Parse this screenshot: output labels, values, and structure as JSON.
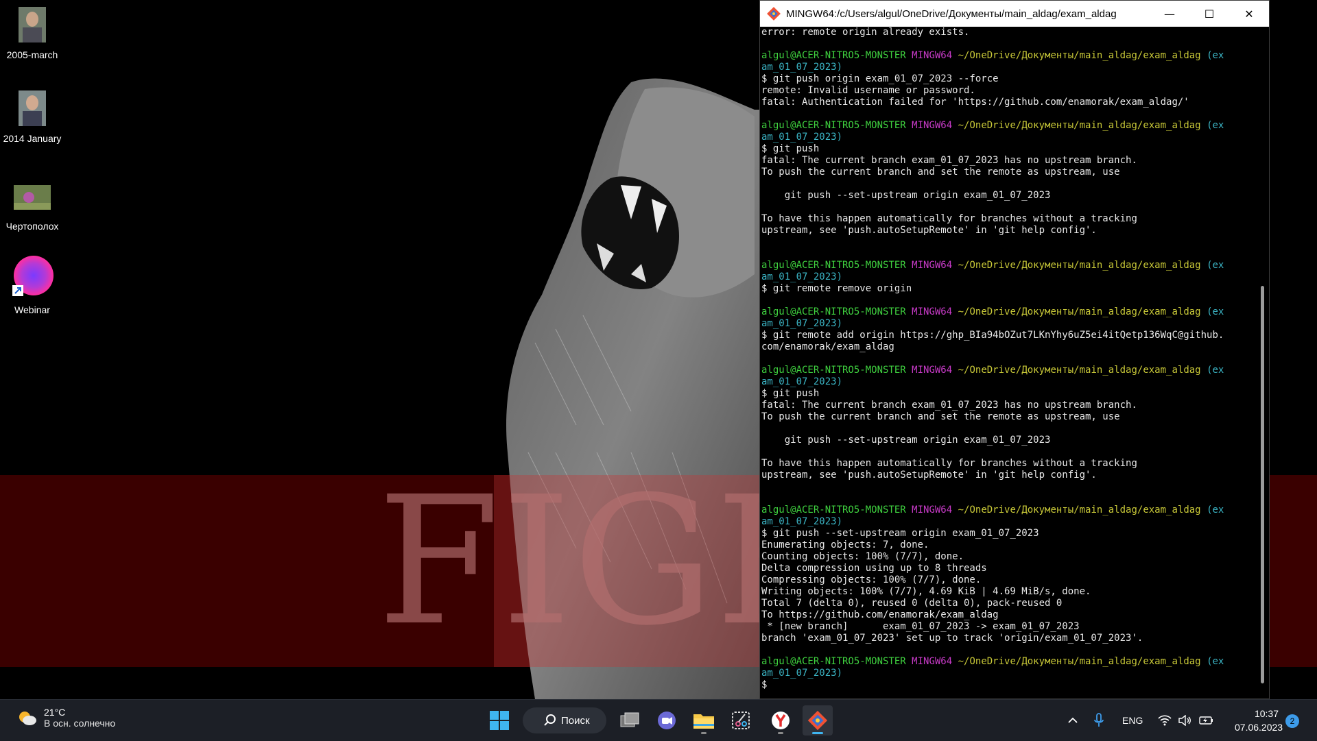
{
  "desktop": {
    "icons": [
      {
        "label": "2005-march"
      },
      {
        "label": "2014  January"
      },
      {
        "label": "Чертополох"
      },
      {
        "label": "Webinar"
      }
    ],
    "wallpaper_text": "FIGH"
  },
  "window": {
    "title": "MINGW64:/c/Users/algul/OneDrive/Документы/main_aldag/exam_aldag",
    "controls": {
      "minimize": "—",
      "maximize": "☐",
      "close": "✕"
    },
    "prompt": {
      "user": "algul@ACER-NITRO5-MONSTER",
      "shell": "MINGW64",
      "path": "~/OneDrive/Документы/main_aldag/exam_aldag",
      "branch_part1": "(ex",
      "branch_part2": "am_01_07_2023)"
    },
    "lines": [
      {
        "kind": "out",
        "text": "error: remote origin already exists."
      },
      {
        "kind": "blank",
        "text": ""
      },
      {
        "kind": "prompt",
        "text": ""
      },
      {
        "kind": "branch2",
        "text": ""
      },
      {
        "kind": "out",
        "text": "$ git push origin exam_01_07_2023 --force"
      },
      {
        "kind": "out",
        "text": "remote: Invalid username or password."
      },
      {
        "kind": "out",
        "text": "fatal: Authentication failed for 'https://github.com/enamorak/exam_aldag/'"
      },
      {
        "kind": "blank",
        "text": ""
      },
      {
        "kind": "prompt",
        "text": ""
      },
      {
        "kind": "branch2",
        "text": ""
      },
      {
        "kind": "out",
        "text": "$ git push"
      },
      {
        "kind": "out",
        "text": "fatal: The current branch exam_01_07_2023 has no upstream branch."
      },
      {
        "kind": "out",
        "text": "To push the current branch and set the remote as upstream, use"
      },
      {
        "kind": "blank",
        "text": ""
      },
      {
        "kind": "out",
        "text": "    git push --set-upstream origin exam_01_07_2023"
      },
      {
        "kind": "blank",
        "text": ""
      },
      {
        "kind": "out",
        "text": "To have this happen automatically for branches without a tracking"
      },
      {
        "kind": "out",
        "text": "upstream, see 'push.autoSetupRemote' in 'git help config'."
      },
      {
        "kind": "blank",
        "text": ""
      },
      {
        "kind": "blank",
        "text": ""
      },
      {
        "kind": "prompt",
        "text": ""
      },
      {
        "kind": "branch2",
        "text": ""
      },
      {
        "kind": "out",
        "text": "$ git remote remove origin"
      },
      {
        "kind": "blank",
        "text": ""
      },
      {
        "kind": "prompt",
        "text": ""
      },
      {
        "kind": "branch2",
        "text": ""
      },
      {
        "kind": "out",
        "text": "$ git remote add origin https://ghp_BIa94bOZut7LKnYhy6uZ5ei4itQetp136WqC@github."
      },
      {
        "kind": "out",
        "text": "com/enamorak/exam_aldag"
      },
      {
        "kind": "blank",
        "text": ""
      },
      {
        "kind": "prompt",
        "text": ""
      },
      {
        "kind": "branch2",
        "text": ""
      },
      {
        "kind": "out",
        "text": "$ git push"
      },
      {
        "kind": "out",
        "text": "fatal: The current branch exam_01_07_2023 has no upstream branch."
      },
      {
        "kind": "out",
        "text": "To push the current branch and set the remote as upstream, use"
      },
      {
        "kind": "blank",
        "text": ""
      },
      {
        "kind": "out",
        "text": "    git push --set-upstream origin exam_01_07_2023"
      },
      {
        "kind": "blank",
        "text": ""
      },
      {
        "kind": "out",
        "text": "To have this happen automatically for branches without a tracking"
      },
      {
        "kind": "out",
        "text": "upstream, see 'push.autoSetupRemote' in 'git help config'."
      },
      {
        "kind": "blank",
        "text": ""
      },
      {
        "kind": "blank",
        "text": ""
      },
      {
        "kind": "prompt",
        "text": ""
      },
      {
        "kind": "branch2",
        "text": ""
      },
      {
        "kind": "out",
        "text": "$ git push --set-upstream origin exam_01_07_2023"
      },
      {
        "kind": "out",
        "text": "Enumerating objects: 7, done."
      },
      {
        "kind": "out",
        "text": "Counting objects: 100% (7/7), done."
      },
      {
        "kind": "out",
        "text": "Delta compression using up to 8 threads"
      },
      {
        "kind": "out",
        "text": "Compressing objects: 100% (7/7), done."
      },
      {
        "kind": "out",
        "text": "Writing objects: 100% (7/7), 4.69 KiB | 4.69 MiB/s, done."
      },
      {
        "kind": "out",
        "text": "Total 7 (delta 0), reused 0 (delta 0), pack-reused 0"
      },
      {
        "kind": "out",
        "text": "To https://github.com/enamorak/exam_aldag"
      },
      {
        "kind": "out",
        "text": " * [new branch]      exam_01_07_2023 -> exam_01_07_2023"
      },
      {
        "kind": "out",
        "text": "branch 'exam_01_07_2023' set up to track 'origin/exam_01_07_2023'."
      },
      {
        "kind": "blank",
        "text": ""
      },
      {
        "kind": "prompt",
        "text": ""
      },
      {
        "kind": "branch2",
        "text": ""
      },
      {
        "kind": "out",
        "text": "$"
      }
    ]
  },
  "taskbar": {
    "weather": {
      "temp": "21°C",
      "desc": "В осн. солнечно"
    },
    "search_label": "Поиск",
    "tray": {
      "language": "ENG",
      "time": "10:37",
      "date": "07.06.2023",
      "notifications": "2"
    },
    "apps": [
      {
        "name": "start",
        "icon": "windows-logo"
      },
      {
        "name": "search",
        "icon": "search-icon"
      },
      {
        "name": "task-view",
        "icon": "task-view-icon"
      },
      {
        "name": "chat",
        "icon": "video-chat-icon"
      },
      {
        "name": "file-explorer",
        "icon": "folder-icon"
      },
      {
        "name": "snipping-tool",
        "icon": "snipping-icon"
      },
      {
        "name": "yandex-browser",
        "icon": "yandex-icon"
      },
      {
        "name": "git-bash",
        "icon": "git-icon"
      }
    ]
  },
  "colors": {
    "prompt_user": "#3fd13f",
    "prompt_shell": "#c73ac7",
    "prompt_path": "#c9c938",
    "prompt_branch": "#3bb5c5",
    "taskbar_bg": "#1c1f26",
    "notification_badge": "#3d9be9"
  }
}
